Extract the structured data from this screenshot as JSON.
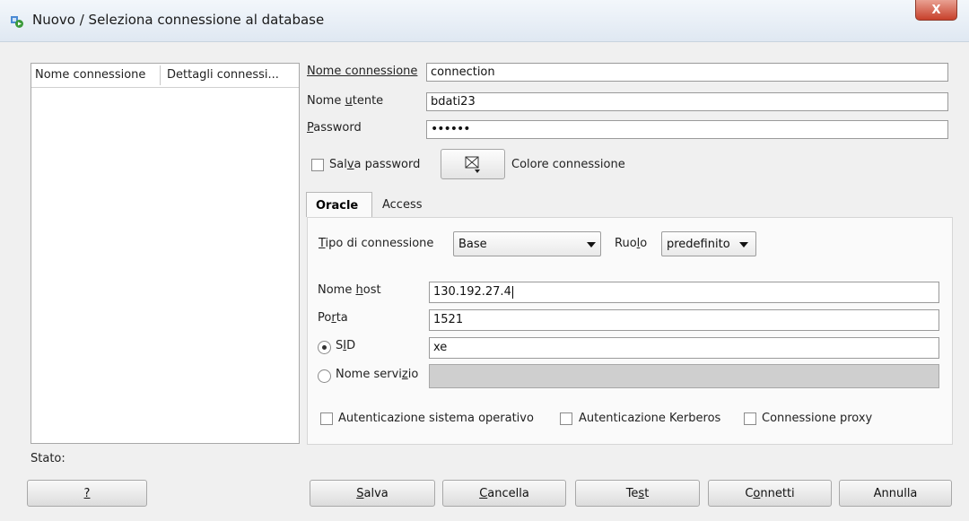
{
  "window": {
    "title": "Nuovo / Seleziona connessione al database",
    "close_label": "X"
  },
  "list": {
    "columns": [
      "Nome connessione",
      "Dettagli connessi..."
    ]
  },
  "form": {
    "name_label": "Nome connessione",
    "name_value": "connection",
    "user_label_pre": "Nome ",
    "user_label_u": "u",
    "user_label_post": "tente",
    "user_value": "bdati23",
    "password_label_u": "P",
    "password_label_post": "assword",
    "password_value": "••••••",
    "save_password_pre": "Sal",
    "save_password_u": "v",
    "save_password_post": "a password",
    "color_label": "Colore connessione"
  },
  "tabs": {
    "oracle": "Oracle",
    "access": "Access"
  },
  "oracle": {
    "conn_type_label_u": "T",
    "conn_type_label_post": "ipo di connessione",
    "conn_type_value": "Base",
    "role_label_pre": "Ruo",
    "role_label_u": "l",
    "role_label_post": "o",
    "role_value": "predefinito",
    "host_label_pre": "Nome ",
    "host_label_u": "h",
    "host_label_post": "ost",
    "host_value": "130.192.27.4",
    "port_label_pre": "Po",
    "port_label_u": "r",
    "port_label_post": "ta",
    "port_value": "1521",
    "sid_label_pre": "S",
    "sid_label_u": "I",
    "sid_label_post": "D",
    "sid_value": "xe",
    "service_label_pre": "Nome servi",
    "service_label_u": "z",
    "service_label_post": "io",
    "os_auth_label": "Autenticazione sistema operativo",
    "kerberos_label": "Autenticazione Kerberos",
    "proxy_label": "Connessione proxy"
  },
  "status_label": "Stato:",
  "buttons": {
    "help": "?",
    "save_u": "S",
    "save_post": "alva",
    "cancel_u": "C",
    "cancel_post": "ancella",
    "test_pre": "Te",
    "test_u": "s",
    "test_post": "t",
    "connect_pre": "C",
    "connect_u": "o",
    "connect_post": "nnetti",
    "close": "Annulla"
  }
}
